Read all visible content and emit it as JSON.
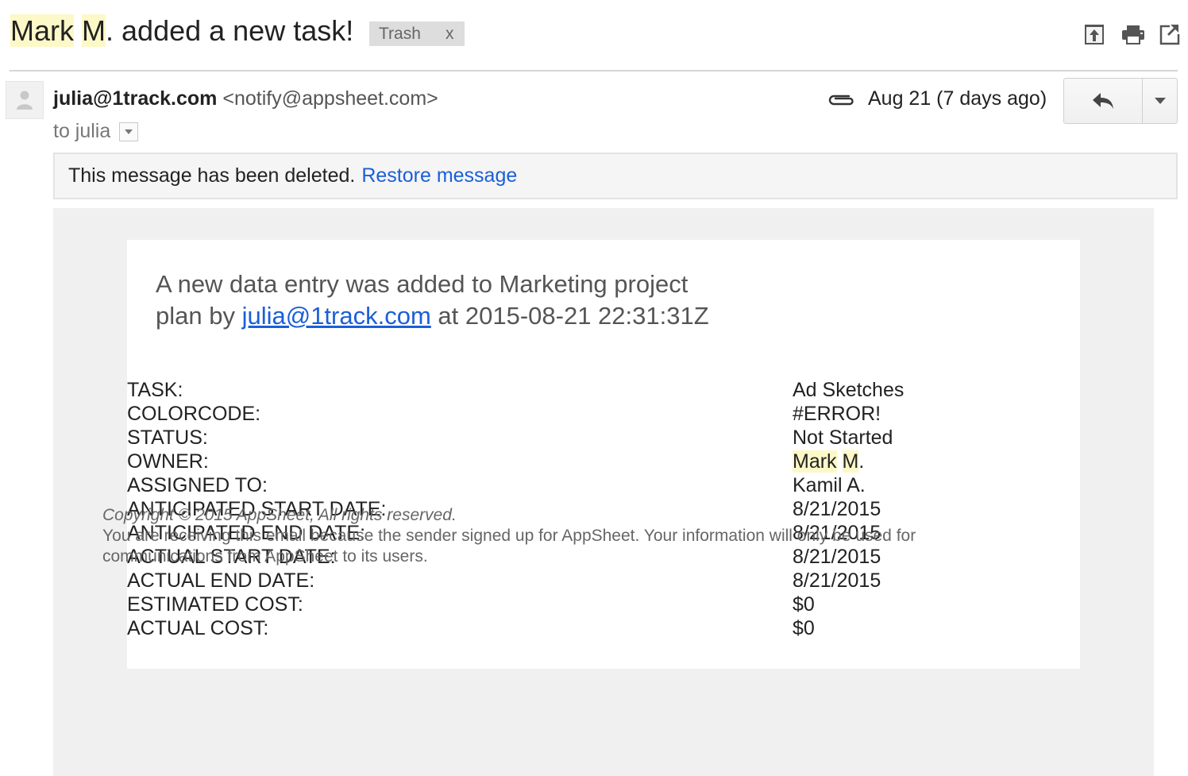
{
  "subject": {
    "owner_first": "Mark",
    "owner_initial": "M",
    "rest": ". added a new task!",
    "label": "Trash",
    "label_remove": "x"
  },
  "toolbar_icons": [
    "archive-up-icon",
    "print-icon",
    "open-in-new-window-icon"
  ],
  "sender": {
    "name": "julia@1track.com",
    "address": "<notify@appsheet.com>",
    "to": "to julia",
    "date": "Aug 21 (7 days ago)"
  },
  "notice": {
    "text": "This message has been deleted.",
    "action": "Restore message"
  },
  "body": {
    "intro_before": "A new data entry was added to Marketing project plan by ",
    "intro_link": "julia@1track.com",
    "intro_after": " at 2015-08-21 22:31:31Z",
    "fields": [
      {
        "label": "TASK:",
        "value": "Ad Sketches"
      },
      {
        "label": "COLORCODE:",
        "value": "#ERROR!"
      },
      {
        "label": "STATUS:",
        "value": "Not Started"
      },
      {
        "label": "OWNER:",
        "value_first": "Mark",
        "value_initial": "M",
        "value_rest": "."
      },
      {
        "label": "ASSIGNED TO:",
        "value": "Kamil A."
      },
      {
        "label": "ANTICIPATED START DATE:",
        "value": "8/21/2015"
      },
      {
        "label": "ANTICIPATED END DATE:",
        "value": "8/21/2015"
      },
      {
        "label": "ACTUAL START DATE:",
        "value": "8/21/2015"
      },
      {
        "label": "ACTUAL END DATE:",
        "value": "8/21/2015"
      },
      {
        "label": "ESTIMATED COST:",
        "value": "$0"
      },
      {
        "label": "ACTUAL COST:",
        "value": "$0"
      }
    ]
  },
  "footer": {
    "copyright": "Copyright © 2015 AppSheet, All rights reserved.",
    "notice": "You are receiving this email because the sender signed up for AppSheet. Your information will only be used for communications from AppSheet to its users."
  },
  "colors": {
    "highlight": "#fdf8c8",
    "link": "#1a5fd8",
    "body_bg": "#f0f0f0",
    "chip_bg": "#dddddd"
  }
}
